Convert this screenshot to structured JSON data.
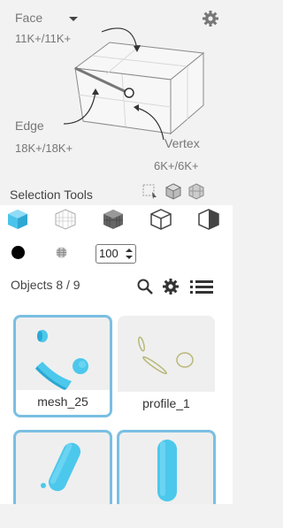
{
  "diagram": {
    "mode": "Face",
    "face_count": "11K+/11K+",
    "edge_label": "Edge",
    "edge_count": "18K+/18K+",
    "vertex_label": "Vertex",
    "vertex_count": "6K+/6K+"
  },
  "selection_tools": {
    "title": "Selection Tools",
    "small_tools": [
      "box-select-icon",
      "cube-select-icon",
      "grid-cube-icon"
    ],
    "tools": [
      "cube-solid-icon",
      "cube-wireframe-icon",
      "cube-grid-dark-icon",
      "cube-outline-icon",
      "cube-half-icon"
    ]
  },
  "brush": {
    "size": "100"
  },
  "objects": {
    "title": "Objects 8 / 9",
    "items": [
      {
        "label": "mesh_25",
        "selected": true
      },
      {
        "label": "profile_1",
        "selected": false
      },
      {
        "label": "",
        "selected": true
      },
      {
        "label": "",
        "selected": true
      }
    ]
  },
  "colors": {
    "accent": "#7abfe2",
    "mesh": "#4cc8ec",
    "profile": "#b8b878"
  }
}
